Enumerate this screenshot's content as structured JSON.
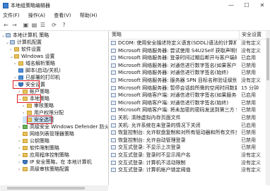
{
  "window": {
    "title": "本地组策略编辑器",
    "min": "—",
    "max": "☐",
    "close": "✕"
  },
  "menu": [
    "文件(F)",
    "操作(A)",
    "查看(V)",
    "帮助(H)"
  ],
  "toolbar": [
    "back-icon",
    "forward-icon",
    "up-icon",
    "show-tree-icon",
    "list-icon",
    "refresh-icon",
    "help-icon"
  ],
  "tree": [
    {
      "label": "本地计算机 策略",
      "icon": "computer-icon",
      "twist": "v"
    },
    {
      "label": "计算机配置",
      "icon": "computer-icon",
      "twist": "v"
    },
    {
      "label": "软件设置",
      "icon": "folder-icon",
      "twist": ">"
    },
    {
      "label": "Windows 设置",
      "icon": "folder-icon",
      "twist": "v"
    },
    {
      "label": "域名解析策略",
      "icon": "folder-icon",
      "twist": ">"
    },
    {
      "label": "脚本(启动/关机)",
      "icon": "page-icon",
      "twist": ""
    },
    {
      "label": "已部署的打印机",
      "icon": "printer-icon",
      "twist": ">"
    },
    {
      "label": "安全设置",
      "icon": "shield-icon",
      "twist": "v"
    },
    {
      "label": "帐户策略",
      "icon": "folder-icon",
      "twist": ">"
    },
    {
      "label": "本地策略",
      "icon": "folder-icon",
      "twist": "v"
    },
    {
      "label": "审核策略",
      "icon": "folder-icon",
      "twist": ">"
    },
    {
      "label": "用户权限分配",
      "icon": "folder-icon",
      "twist": ">"
    },
    {
      "label": "安全选项",
      "icon": "folder-icon",
      "twist": ""
    },
    {
      "label": "高级安全 Windows Defender 防火",
      "icon": "folder-icon",
      "twist": ">"
    },
    {
      "label": "网络列表管理器策略",
      "icon": "folder-icon",
      "twist": ""
    },
    {
      "label": "公钥策略",
      "icon": "folder-icon",
      "twist": ">"
    },
    {
      "label": "软件限制策略",
      "icon": "folder-icon",
      "twist": ">"
    },
    {
      "label": "应用程序控制策略",
      "icon": "folder-icon",
      "twist": ">"
    },
    {
      "label": "IP 安全策略，在 本地计算机",
      "icon": "shield-icon",
      "twist": ">"
    },
    {
      "label": "高级审核策略配置",
      "icon": "folder-icon",
      "twist": ">"
    }
  ],
  "list_header": {
    "policy": "策略",
    "setting": "安全设置"
  },
  "policies": [
    {
      "name": "DCOM: 使用安全描述符定义语言(SDDL)语法的计算机启动...",
      "setting": "没有定义"
    },
    {
      "name": "Microsoft 网络服务器: 尝试使用 S4U2Self 获取声明信息",
      "setting": "没有定义"
    },
    {
      "name": "Microsoft 网络服务器: 登录时间过期后断开与客户端的连接",
      "setting": "已启用"
    },
    {
      "name": "Microsoft 网络服务器: 对通信进行数字签名(如果客户端允许)",
      "setting": "已禁用"
    },
    {
      "name": "Microsoft 网络服务器: 对通信进行数字签名(始终)",
      "setting": "已禁用"
    },
    {
      "name": "Microsoft 网络服务器: 服务器 SPN 目标名称验证级别",
      "setting": "没有定义"
    },
    {
      "name": "Microsoft 网络服务器: 暂停会话前所需的空闲时间数量",
      "setting": "15 分钟"
    },
    {
      "name": "Microsoft 网络客户端: 对通信进行数字签名(如果服务器允许)",
      "setting": "已启用"
    },
    {
      "name": "Microsoft 网络客户端: 对通信进行数字签名(始终)",
      "setting": "已禁用"
    },
    {
      "name": "Microsoft 网络客户端: 将未加密的密码发送到第三方 SMB...",
      "setting": "已禁用"
    },
    {
      "name": "关机: 清除虚拟内存页面文件",
      "setting": "已禁用"
    },
    {
      "name": "关机: 允许系统在未登录的情况下关闭",
      "setting": "已启用"
    },
    {
      "name": "恢复控制台: 允许软盘复制和对所有驱动器和所有文件夹",
      "setting": "已禁用"
    },
    {
      "name": "恢复控制台: 允许自动管理登录",
      "setting": "已禁用"
    },
    {
      "name": "交互式登录: 不显示上次登录",
      "setting": "已禁用"
    },
    {
      "name": "交互式登录: 登录时不显示用户名",
      "setting": "没有定义"
    },
    {
      "name": "交互式登录: 计算机不活动限制",
      "setting": "没有定义"
    },
    {
      "name": "交互式登录: 计算机帐户锁定阈值",
      "setting": "没有定义"
    }
  ],
  "colors": {
    "selection": "#cce4f7",
    "annotation": "#e0151a"
  }
}
